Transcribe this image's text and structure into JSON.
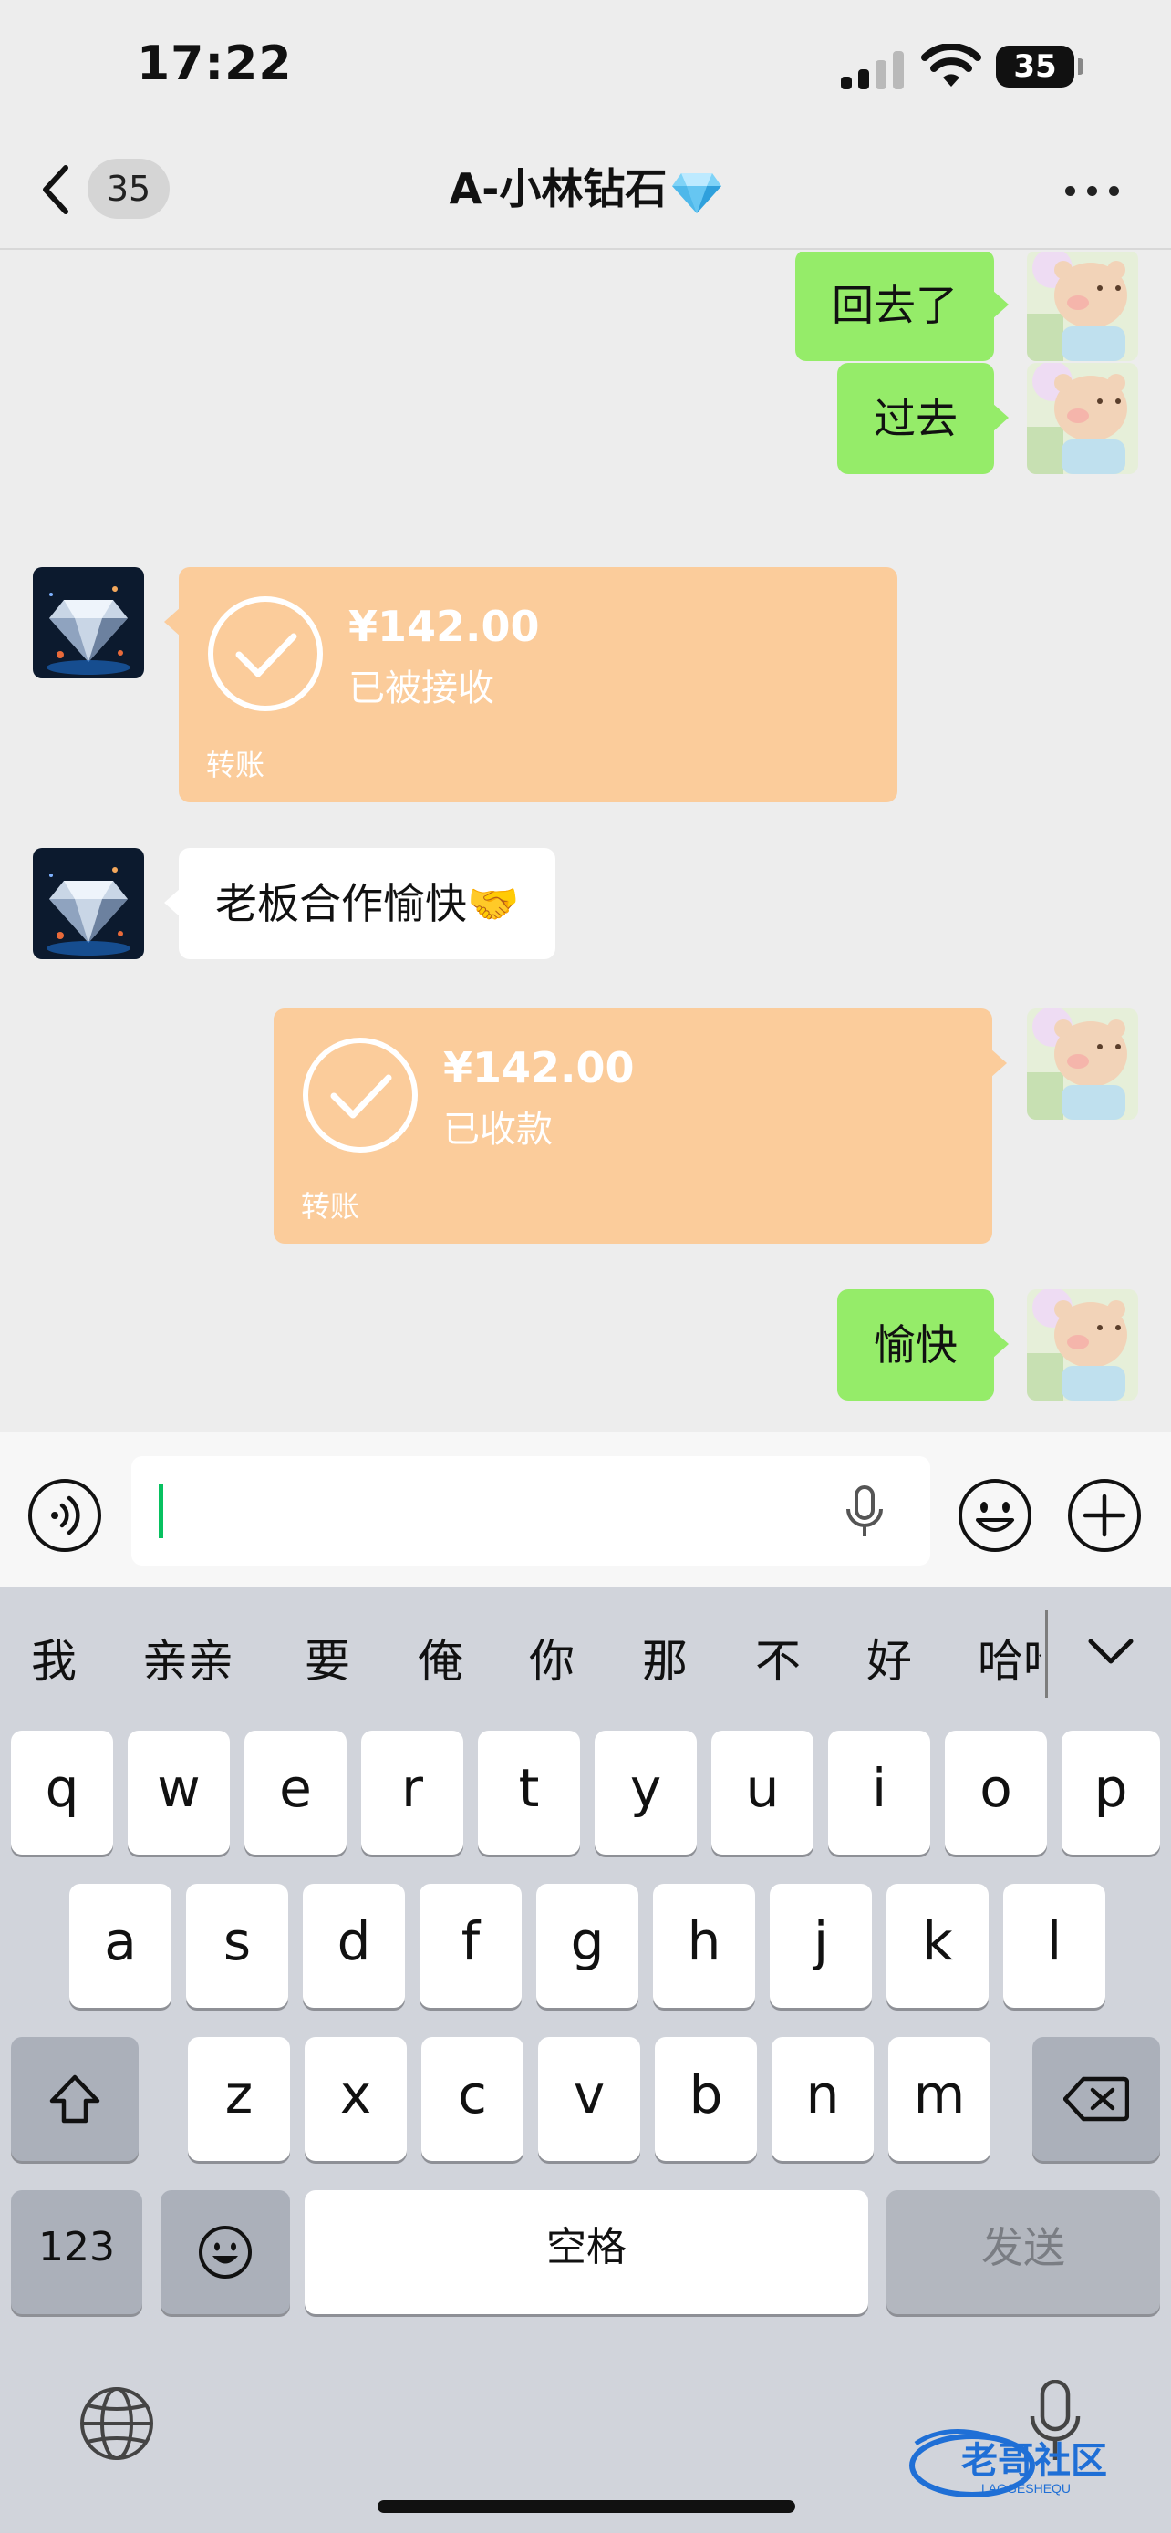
{
  "status_bar": {
    "time": "17:22",
    "battery": "35"
  },
  "nav": {
    "unread_count": "35",
    "title": "A-小林钻石"
  },
  "messages": {
    "m1": {
      "sender": "me",
      "text": "回去了"
    },
    "m2": {
      "sender": "me",
      "text": "过去"
    },
    "m3": {
      "sender": "other",
      "type": "transfer",
      "amount": "¥142.00",
      "status": "已被接收",
      "label": "转账"
    },
    "m4": {
      "sender": "other",
      "text": "老板合作愉快🤝"
    },
    "m5": {
      "sender": "me",
      "type": "transfer",
      "amount": "¥142.00",
      "status": "已收款",
      "label": "转账"
    },
    "m6": {
      "sender": "me",
      "text": "愉快"
    }
  },
  "input": {
    "value": ""
  },
  "keyboard": {
    "candidates": [
      "我",
      "亲亲",
      "要",
      "俺",
      "你",
      "那",
      "不",
      "好",
      "哈哈"
    ],
    "row1": [
      "q",
      "w",
      "e",
      "r",
      "t",
      "y",
      "u",
      "i",
      "o",
      "p"
    ],
    "row2": [
      "a",
      "s",
      "d",
      "f",
      "g",
      "h",
      "j",
      "k",
      "l"
    ],
    "row3": [
      "z",
      "x",
      "c",
      "v",
      "b",
      "n",
      "m"
    ],
    "numbers_label": "123",
    "space_label": "空格",
    "send_label": "发送"
  },
  "watermark": {
    "text": "老哥社区",
    "subtext": "LAOGESHEQU"
  },
  "colors": {
    "my_bubble": "#95ec69",
    "other_bubble": "#ffffff",
    "transfer_card": "#fbcc9b",
    "chat_background": "#ededed",
    "caret": "#07c160",
    "keyboard_background": "#d1d4db"
  }
}
